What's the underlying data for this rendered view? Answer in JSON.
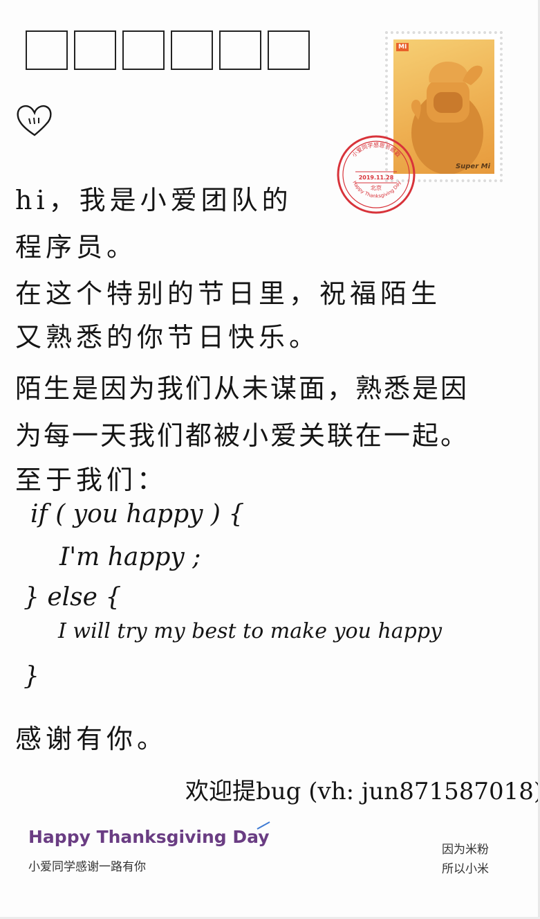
{
  "postcode_boxes": 6,
  "stamp": {
    "logo": "MI",
    "brand": "Super Mi"
  },
  "postmark": {
    "ring_text": "小爱同学感恩节邮戳",
    "date": "2019.11.28",
    "city": "北京",
    "ring_text_bottom": "Happy Thanksgiving Day",
    "color": "#d8333a"
  },
  "letter": {
    "lines": [
      "hi，我是小爱团队的",
      "程序员。",
      "在这个特别的节日里，祝福陌生",
      "又熟悉的你节日快乐。",
      "陌生是因为我们从未谋面，熟悉是因",
      "为每一天我们都被小爱关联在一起。",
      "至于我们：",
      "if ( you happy ) {",
      "I'm happy ;",
      "} else {",
      "I will try my best to make you happy",
      "}",
      "感谢有你。"
    ],
    "signature": "欢迎提bug (vh: jun871587018)"
  },
  "footer": {
    "title": "Happy Thanksgiving Day",
    "subtitle": "小爱同学感谢一路有你",
    "slogan_line1": "因为米粉",
    "slogan_line2": "所以小米",
    "title_color": "#6a3d83"
  }
}
